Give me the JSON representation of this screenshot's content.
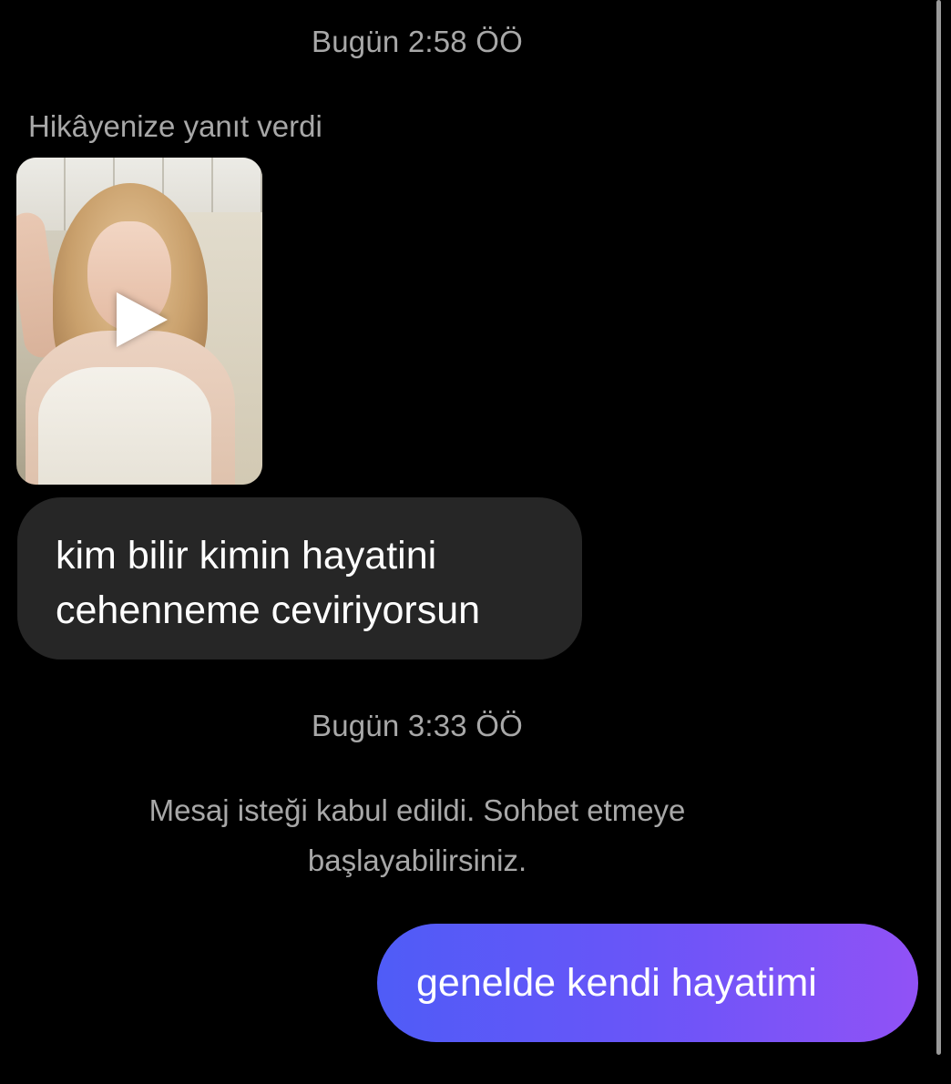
{
  "chat": {
    "timestamps": [
      "Bugün 2:58 ÖÖ",
      "Bugün 3:33 ÖÖ"
    ],
    "story_reply": {
      "label": "Hikâyenize yanıt verdi",
      "thumbnail_icon": "play-icon"
    },
    "incoming_message": {
      "lines": [
        "kim bilir kimin hayatini",
        "cehenneme ceviriyorsun"
      ]
    },
    "system_message": {
      "lines": [
        "Mesaj isteği kabul edildi. Sohbet etmeye",
        "başlayabilirsiniz."
      ]
    },
    "outgoing_message": {
      "text": "genelde kendi hayatimi"
    }
  },
  "colors": {
    "background": "#000000",
    "incoming_bubble": "#262626",
    "outgoing_gradient_start": "#4f5cf7",
    "outgoing_gradient_end": "#9152f6",
    "meta_text": "#a8a8a8"
  }
}
